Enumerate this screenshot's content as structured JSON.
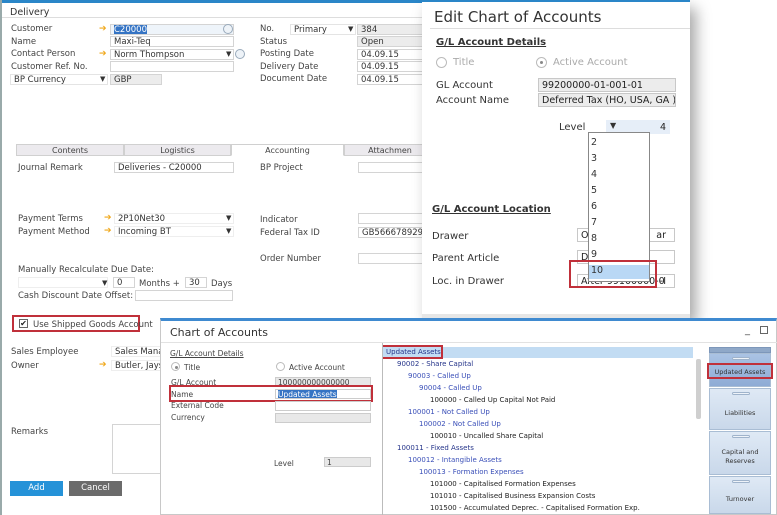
{
  "delivery": {
    "title": "Delivery",
    "header_left": [
      {
        "label": "Customer",
        "value": "C20000",
        "link_arrow": true,
        "selected": true
      },
      {
        "label": "Name",
        "value": "Maxi-Teq"
      },
      {
        "label": "Contact Person",
        "value": "Norm Thompson",
        "link_arrow": true,
        "dropdown": true
      },
      {
        "label": "Customer Ref. No.",
        "value": ""
      },
      {
        "label": "BP Currency",
        "value": "GBP",
        "dropdown": true
      }
    ],
    "header_right": {
      "no_label": "No.",
      "series": "Primary",
      "no_value": "384",
      "status_label": "Status",
      "status_value": "Open",
      "posting_date_label": "Posting Date",
      "posting_date": "04.09.15",
      "delivery_date_label": "Delivery Date",
      "delivery_date": "04.09.15",
      "document_date_label": "Document Date",
      "document_date": "04.09.15"
    },
    "tabs": [
      {
        "label": "Contents",
        "active": false
      },
      {
        "label": "Logistics",
        "active": false
      },
      {
        "label": "Accounting",
        "active": true
      },
      {
        "label": "Attachmen",
        "active": false
      }
    ],
    "accounting": {
      "journal_remark_label": "Journal Remark",
      "journal_remark": "Deliveries - C20000",
      "bp_project_label": "BP Project",
      "bp_project": "",
      "payment_terms_label": "Payment Terms",
      "payment_terms": "2P10Net30",
      "payment_method_label": "Payment Method",
      "payment_method": "Incoming BT",
      "indicator_label": "Indicator",
      "indicator": "",
      "federal_tax_id_label": "Federal Tax ID",
      "federal_tax_id": "GB566678929",
      "order_number_label": "Order Number",
      "order_number": "",
      "recalc_label": "Manually Recalculate Due Date:",
      "recalc_select": "",
      "months": "0",
      "months_label": "Months +",
      "days": "30",
      "days_label": "Days",
      "cash_discount_label": "Cash Discount Date Offset:",
      "cash_discount": "",
      "shipped_goods_label": "Use Shipped Goods Account",
      "shipped_goods_checked": true
    },
    "footer": {
      "sales_employee_label": "Sales Employee",
      "sales_employee": "Sales Manage",
      "owner_label": "Owner",
      "owner": "Butler, Jayson",
      "remarks_label": "Remarks",
      "remarks": ""
    },
    "buttons": {
      "add": "Add",
      "cancel": "Cancel"
    }
  },
  "edit_coa": {
    "title": "Edit Chart of Accounts",
    "details_section": "G/L Account Details",
    "radio_title": "Title",
    "radio_active": "Active Account",
    "selected_radio": "Active Account",
    "gl_account_label": "GL Account",
    "gl_account": "99200000-01-001-01",
    "account_name_label": "Account Name",
    "account_name": "Deferred Tax (HO, USA, GA )",
    "level_label": "Level",
    "level_value": "4",
    "level_options": [
      "2",
      "3",
      "4",
      "5",
      "6",
      "7",
      "8",
      "9",
      "10"
    ],
    "level_highlighted": "10",
    "location_section": "G/L Account Location",
    "drawer_label": "Drawer",
    "drawer_value": "O",
    "drawer_value_tail": "ar",
    "parent_article_label": "Parent Article",
    "parent_article_value": "D",
    "loc_in_drawer_label": "Loc. in Drawer",
    "loc_in_drawer_value": "After 99100000-0",
    "loc_in_drawer_tail": "-I"
  },
  "coa": {
    "title": "Chart of Accounts",
    "details_section": "G/L Account Details",
    "radio_title": "Title",
    "radio_active": "Active Account",
    "selected_radio": "Title",
    "gl_account_label": "G/L Account",
    "gl_account": "100000000000000",
    "name_label": "Name",
    "name_value": "Updated Assets",
    "external_code_label": "External Code",
    "external_code": "",
    "currency_label": "Currency",
    "currency": "",
    "level_label": "Level",
    "level": "1",
    "tree": [
      {
        "text": "Updated Assets",
        "indent": 0,
        "color": "dark",
        "selected": true
      },
      {
        "text": "90002 - Share Capital",
        "indent": 1,
        "color": "dark"
      },
      {
        "text": "90003 - Called Up",
        "indent": 2,
        "color": "blue"
      },
      {
        "text": "90004 - Called Up",
        "indent": 3,
        "color": "blue"
      },
      {
        "text": "100000 - Called Up Capital Not Paid",
        "indent": 4,
        "color": "black"
      },
      {
        "text": "100001 - Not Called Up",
        "indent": 2,
        "color": "blue"
      },
      {
        "text": "100002 - Not Called Up",
        "indent": 3,
        "color": "blue"
      },
      {
        "text": "100010 - Uncalled Share Capital",
        "indent": 4,
        "color": "black"
      },
      {
        "text": "100011 - Fixed Assets",
        "indent": 1,
        "color": "dark"
      },
      {
        "text": "100012 - Intangible Assets",
        "indent": 2,
        "color": "blue"
      },
      {
        "text": "100013 - Formation Expenses",
        "indent": 3,
        "color": "blue"
      },
      {
        "text": "101000 - Capitalised Formation Expenses",
        "indent": 4,
        "color": "black"
      },
      {
        "text": "101010 - Capitalised Business Expansion Costs",
        "indent": 4,
        "color": "black"
      },
      {
        "text": "101500 - Accumulated Deprec. - Capitalised Formation Exp.",
        "indent": 4,
        "color": "black"
      }
    ],
    "drawers": [
      "Updated Assets",
      "Liabilities",
      "Capital and Reserves",
      "Turnover"
    ],
    "active_drawer": "Updated Assets"
  },
  "colors": {
    "accent_blue": "#2a86c8",
    "add_button": "#2592d8",
    "cancel_button": "#6b6b6b",
    "highlight_red": "#c0303a",
    "link_arrow": "#f0a81c",
    "selection_blue": "#b9d8f5"
  }
}
